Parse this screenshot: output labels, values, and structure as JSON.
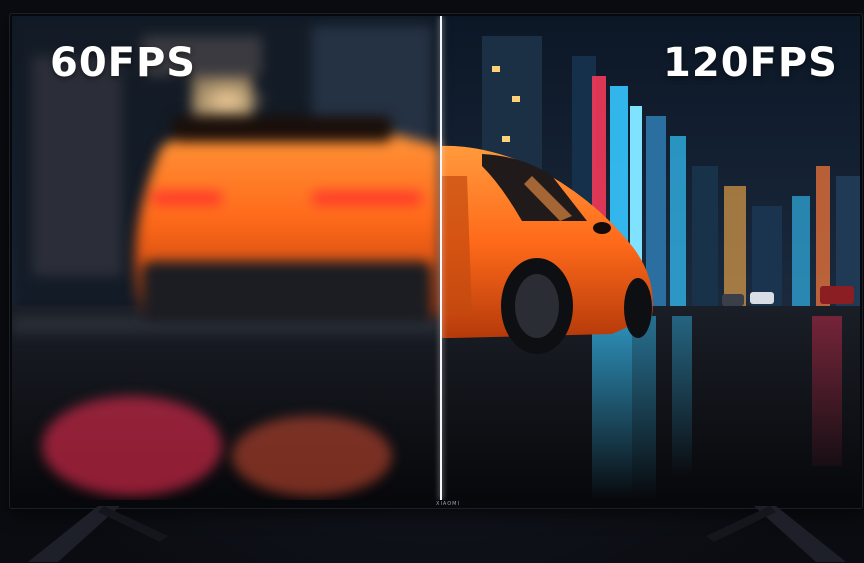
{
  "labels": {
    "left_fps": "60FPS",
    "right_fps": "120FPS",
    "brand": "XIAOMI"
  },
  "colors": {
    "car": "#ff6a1a",
    "neon_cyan": "#35c6ff",
    "neon_red": "#ff2f55",
    "divider": "#f4f6fb"
  }
}
